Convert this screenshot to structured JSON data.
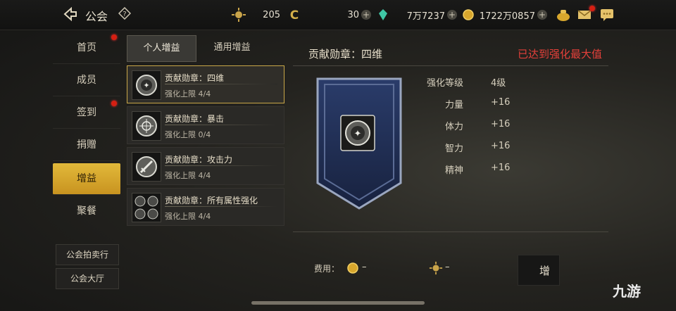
{
  "header": {
    "title": "公会",
    "currencies": [
      {
        "icon": "sun-token-icon",
        "value": "205"
      },
      {
        "icon": "c-coin-icon",
        "value": "30"
      },
      {
        "icon": "gem-icon",
        "value": "7万7237"
      },
      {
        "icon": "gold-coin-icon",
        "value": "1722万0857"
      }
    ]
  },
  "sidebar": {
    "items": [
      {
        "label": "首页",
        "notify": true
      },
      {
        "label": "成员",
        "notify": false
      },
      {
        "label": "签到",
        "notify": true
      },
      {
        "label": "捐赠",
        "notify": false
      },
      {
        "label": "增益",
        "notify": false,
        "active": true
      },
      {
        "label": "聚餐",
        "notify": false
      }
    ],
    "buttons": [
      "公会拍卖行",
      "公会大厅"
    ]
  },
  "tabs": [
    "个人增益",
    "通用增益"
  ],
  "buffs": [
    {
      "name": "贡献勋章：四维",
      "limit": "强化上限 4/4",
      "icon": "medal-four-dim-icon"
    },
    {
      "name": "贡献勋章：暴击",
      "limit": "强化上限 0/4",
      "icon": "medal-crit-icon"
    },
    {
      "name": "贡献勋章：攻击力",
      "limit": "强化上限 4/4",
      "icon": "medal-attack-icon"
    },
    {
      "name": "贡献勋章：所有属性强化",
      "limit": "强化上限 4/4",
      "icon": "medal-all-attr-icon"
    }
  ],
  "detail": {
    "title": "贡献勋章：四维",
    "status": "已达到强化最大值",
    "stats": [
      {
        "label": "强化等级",
        "value": "4级"
      },
      {
        "label": "力量",
        "value": "+16"
      },
      {
        "label": "体力",
        "value": "+16"
      },
      {
        "label": "智力",
        "value": "+16"
      },
      {
        "label": "精神",
        "value": "+16"
      }
    ],
    "fee_label": "费用：",
    "fee_gold": "–",
    "fee_token": "–",
    "upgrade_label": "增"
  },
  "watermark": "九游",
  "colors": {
    "accent_gold": "#d4a52c",
    "warn_red": "#e4403a"
  }
}
